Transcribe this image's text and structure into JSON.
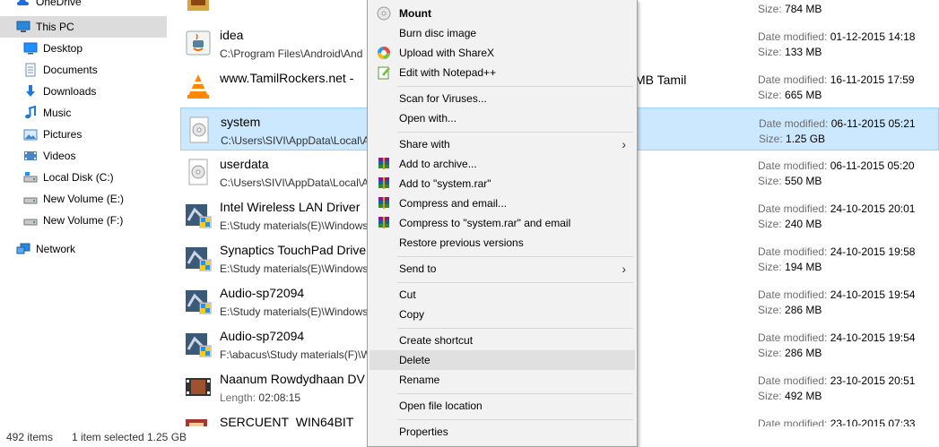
{
  "sidebar": {
    "items": [
      {
        "label": "OneDrive",
        "icon": "cloud-icon"
      },
      {
        "label": "This PC",
        "icon": "computer-icon"
      },
      {
        "label": "Desktop",
        "icon": "desktop-icon"
      },
      {
        "label": "Documents",
        "icon": "documents-icon"
      },
      {
        "label": "Downloads",
        "icon": "downloads-icon"
      },
      {
        "label": "Music",
        "icon": "music-icon"
      },
      {
        "label": "Pictures",
        "icon": "pictures-icon"
      },
      {
        "label": "Videos",
        "icon": "videos-icon"
      },
      {
        "label": "Local Disk (C:)",
        "icon": "drive-c-icon"
      },
      {
        "label": "New Volume (E:)",
        "icon": "drive-icon"
      },
      {
        "label": "New Volume (F:)",
        "icon": "drive-icon"
      },
      {
        "label": "Network",
        "icon": "network-icon"
      }
    ]
  },
  "files": {
    "date_label": "Date modified:",
    "size_label": "Size:",
    "length_label": "Length:",
    "rows": [
      {
        "name": "",
        "path": "",
        "date": "",
        "size": "784 MB",
        "icon": "folder-image-icon"
      },
      {
        "name": "idea",
        "path": "C:\\Program Files\\Android\\And",
        "date": "01-12-2015 14:18",
        "size": "133 MB",
        "icon": "java-icon"
      },
      {
        "name": "www.TamilRockers.net -",
        "path": "",
        "date": "16-11-2015 17:59",
        "size": "665 MB",
        "icon": "vlc-icon"
      },
      {
        "name": "system",
        "path": "C:\\Users\\SIVI\\AppData\\Local\\A",
        "date": "06-11-2015 05:21",
        "size": "1.25 GB",
        "icon": "disc-image-icon"
      },
      {
        "name": "userdata",
        "path": "C:\\Users\\SIVI\\AppData\\Local\\A",
        "date": "06-11-2015 05:20",
        "size": "550 MB",
        "icon": "disc-image-icon"
      },
      {
        "name": "Intel Wireless LAN Driver",
        "path": "E:\\Study materials(E)\\Windows",
        "date": "24-10-2015 20:01",
        "size": "240 MB",
        "icon": "installer-icon"
      },
      {
        "name": "Synaptics TouchPad Drive",
        "path": "E:\\Study materials(E)\\Windows",
        "date": "24-10-2015 19:58",
        "size": "194 MB",
        "icon": "installer-icon"
      },
      {
        "name": "Audio-sp72094",
        "path": "E:\\Study materials(E)\\Windows",
        "date": "24-10-2015 19:54",
        "size": "286 MB",
        "icon": "installer-icon"
      },
      {
        "name": "Audio-sp72094",
        "path": "F:\\abacus\\Study materials(F)\\W",
        "date": "24-10-2015 19:54",
        "size": "286 MB",
        "icon": "installer-icon"
      },
      {
        "name": "Naanum Rowdydhaan DV",
        "path": "02:08:15",
        "date": "23-10-2015 20:51",
        "size": "492 MB",
        "icon": "video-icon"
      },
      {
        "name": "SERCUENT_WIN64BIT",
        "path": "",
        "date": "23-10-2015 07:33",
        "size": "",
        "icon": "installer-icon"
      }
    ],
    "overflow_text": "MB Tamil"
  },
  "context_menu": {
    "items": [
      {
        "label": "Mount",
        "icon": "disc-icon",
        "bold": true
      },
      {
        "label": "Burn disc image",
        "icon": ""
      },
      {
        "label": "Upload with ShareX",
        "icon": "sharex-icon"
      },
      {
        "label": "Edit with Notepad++",
        "icon": "notepad-icon"
      },
      {
        "label": "Scan for Viruses...",
        "icon": ""
      },
      {
        "label": "Open with...",
        "icon": ""
      },
      {
        "label": "Share with",
        "icon": "",
        "submenu": true
      },
      {
        "label": "Add to archive...",
        "icon": "winrar-icon"
      },
      {
        "label": "Add to \"system.rar\"",
        "icon": "winrar-icon"
      },
      {
        "label": "Compress and email...",
        "icon": "winrar-icon"
      },
      {
        "label": "Compress to \"system.rar\" and email",
        "icon": "winrar-icon"
      },
      {
        "label": "Restore previous versions",
        "icon": ""
      },
      {
        "label": "Send to",
        "icon": "",
        "submenu": true
      },
      {
        "label": "Cut",
        "icon": ""
      },
      {
        "label": "Copy",
        "icon": ""
      },
      {
        "label": "Create shortcut",
        "icon": ""
      },
      {
        "label": "Delete",
        "icon": "",
        "hover": true
      },
      {
        "label": "Rename",
        "icon": ""
      },
      {
        "label": "Open file location",
        "icon": ""
      },
      {
        "label": "Properties",
        "icon": ""
      }
    ],
    "submenu_arrow": "›"
  },
  "status_bar": {
    "item_count": "492 items",
    "selection": "1 item selected",
    "selection_size": "1.25 GB"
  },
  "colors": {
    "selection_bg": "#cce8ff",
    "selection_border": "#99d1ff",
    "nav_selected_bg": "#dcdcdc",
    "menu_bg": "#f2f2f2",
    "menu_hover": "#e0e0e0"
  }
}
